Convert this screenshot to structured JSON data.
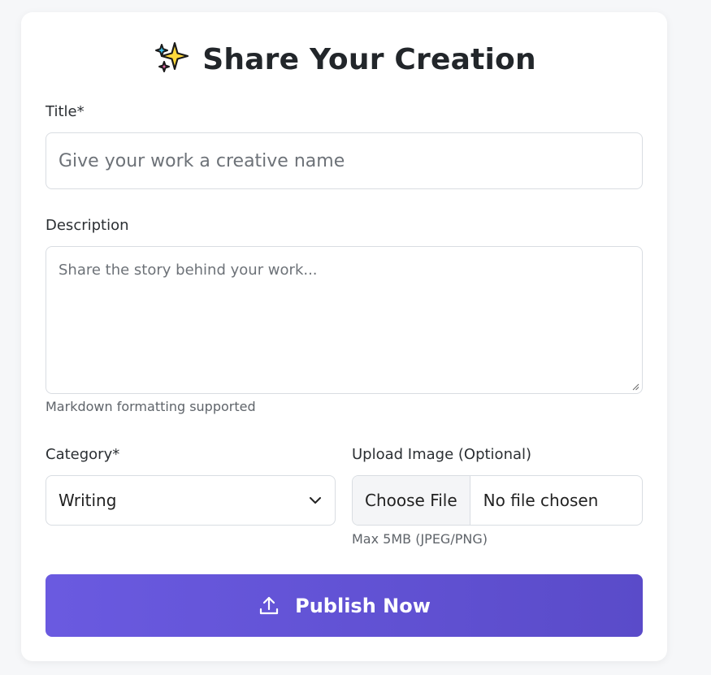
{
  "form": {
    "title": "Share Your Creation",
    "sparkles_icon": "sparkles-icon",
    "title_field": {
      "label": "Title*",
      "placeholder": "Give your work a creative name"
    },
    "description_field": {
      "label": "Description",
      "placeholder": "Share the story behind your work...",
      "hint": "Markdown formatting supported"
    },
    "category_field": {
      "label": "Category*",
      "selected": "Writing",
      "icon": "chevron-down-icon"
    },
    "upload_field": {
      "label": "Upload Image (Optional)",
      "button_label": "Choose File",
      "status": "No file chosen",
      "hint": "Max 5MB (JPEG/PNG)"
    },
    "submit": {
      "label": "Publish Now",
      "icon": "upload-icon"
    }
  },
  "colors": {
    "accent_start": "#6a5ae0",
    "accent_end": "#5a4bc9",
    "background": "#f6f7f9",
    "card": "#ffffff"
  }
}
